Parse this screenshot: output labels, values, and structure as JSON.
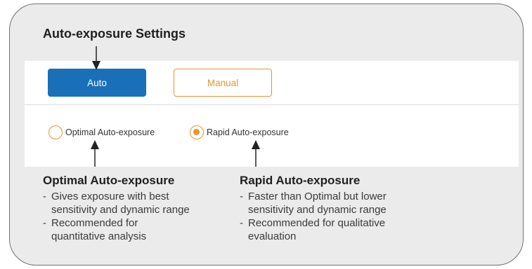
{
  "header": {
    "title": "Auto-exposure Settings"
  },
  "mode_buttons": {
    "auto_label": "Auto",
    "manual_label": "Manual"
  },
  "radios": {
    "optimal_label": "Optimal Auto-exposure",
    "rapid_label": "Rapid Auto-exposure",
    "selected": "Rapid Auto-exposure"
  },
  "descriptions": {
    "optimal": {
      "title": "Optimal Auto-exposure",
      "points": [
        {
          "line1": "Gives exposure with best",
          "line2": "sensitivity and dynamic range"
        },
        {
          "line1": "Recommended for",
          "line2": "quantitative analysis"
        }
      ]
    },
    "rapid": {
      "title": "Rapid Auto-exposure",
      "points": [
        {
          "line1": "Faster than Optimal but lower",
          "line2": "sensitivity and dynamic range"
        },
        {
          "line1": "Recommended for qualitative",
          "line2": "evaluation"
        }
      ]
    }
  },
  "colors": {
    "accent_blue": "#1a70b8",
    "accent_orange": "#e8962e",
    "panel_bg": "#ebebeb"
  },
  "icons": {
    "arrow": "arrow-up-icon"
  }
}
